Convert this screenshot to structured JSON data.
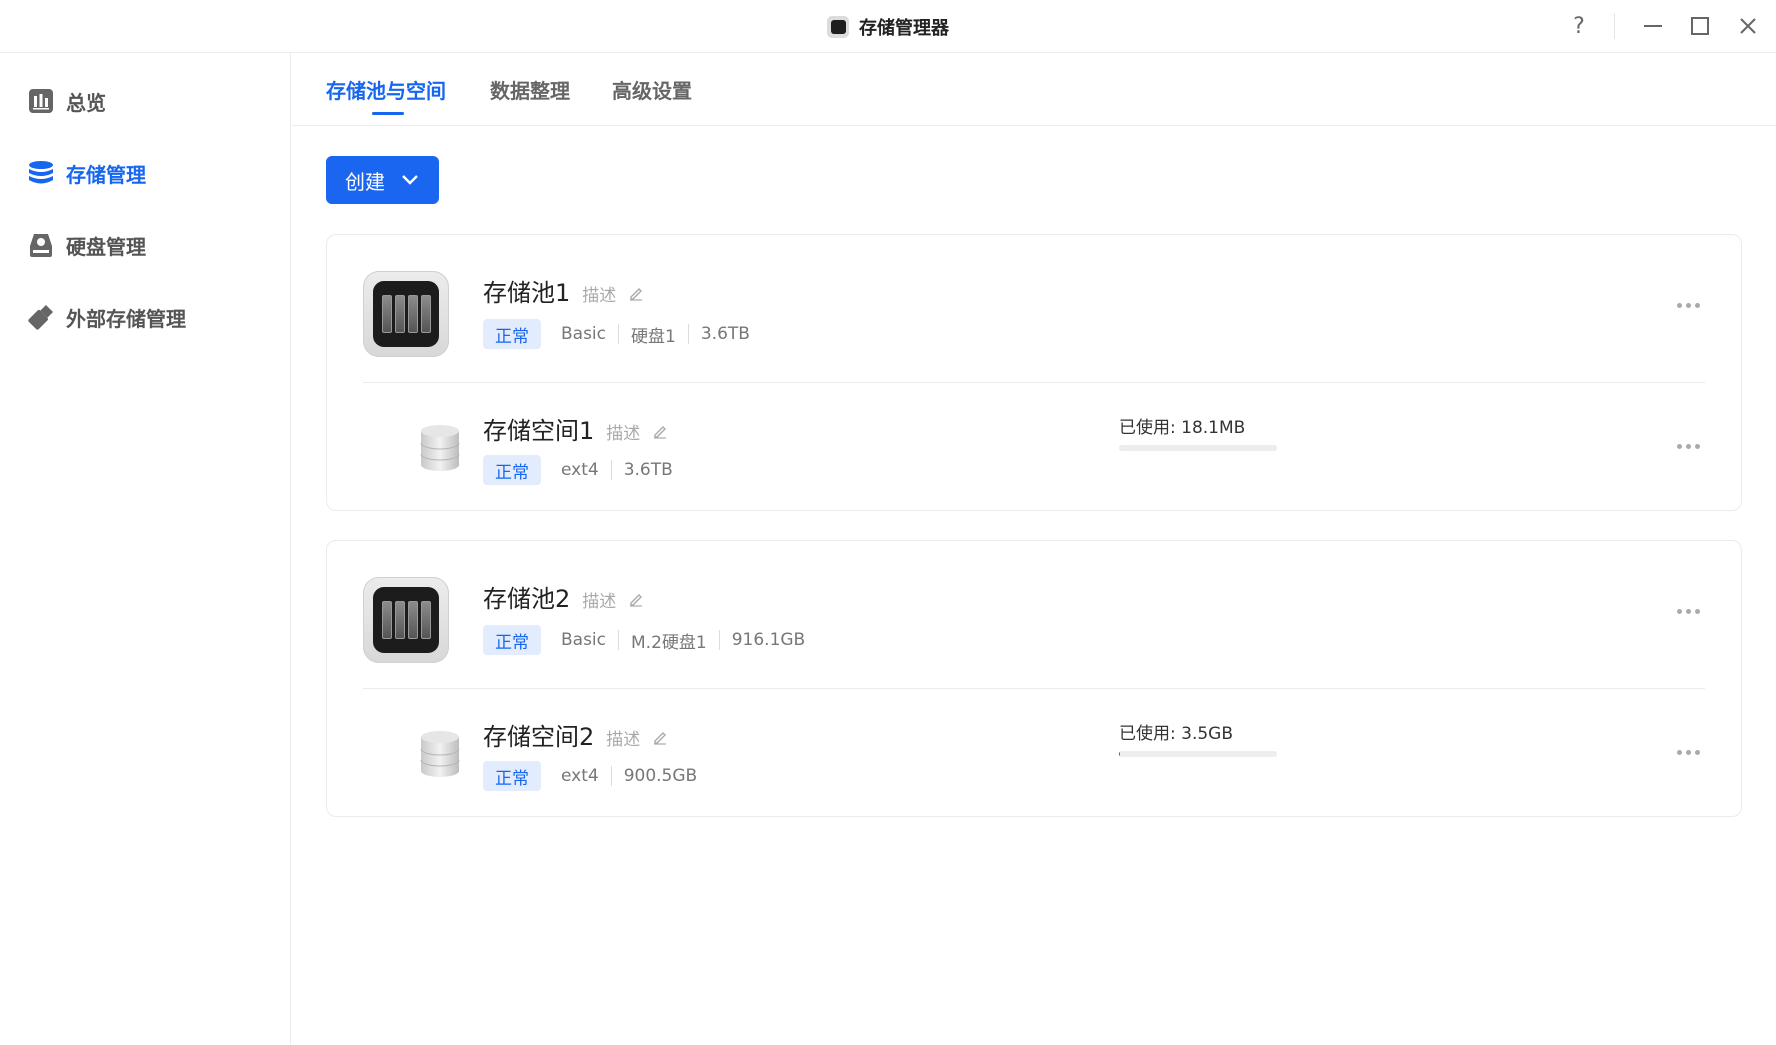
{
  "window": {
    "title": "存储管理器",
    "help_label": "?"
  },
  "sidebar": {
    "items": [
      {
        "label": "总览",
        "icon": "chart-icon",
        "active": false
      },
      {
        "label": "存储管理",
        "icon": "database-icon",
        "active": true
      },
      {
        "label": "硬盘管理",
        "icon": "disk-icon",
        "active": false
      },
      {
        "label": "外部存储管理",
        "icon": "usb-drive-icon",
        "active": false
      }
    ]
  },
  "tabs": [
    {
      "label": "存储池与空间",
      "active": true
    },
    {
      "label": "数据整理",
      "active": false
    },
    {
      "label": "高级设置",
      "active": false
    }
  ],
  "toolbar": {
    "create_label": "创建"
  },
  "pools": [
    {
      "name": "存储池1",
      "desc": "描述",
      "status": "正常",
      "raid": "Basic",
      "disk": "硬盘1",
      "size": "3.6TB",
      "volume": {
        "name": "存储空间1",
        "desc": "描述",
        "status": "正常",
        "fs": "ext4",
        "size": "3.6TB",
        "used_label": "已使用: 18.1MB",
        "used_fraction": 0.0
      }
    },
    {
      "name": "存储池2",
      "desc": "描述",
      "status": "正常",
      "raid": "Basic",
      "disk": "M.2硬盘1",
      "size": "916.1GB",
      "volume": {
        "name": "存储空间2",
        "desc": "描述",
        "status": "正常",
        "fs": "ext4",
        "size": "900.5GB",
        "used_label": "已使用: 3.5GB",
        "used_fraction": 0.004
      }
    }
  ],
  "colors": {
    "accent": "#1666f0",
    "badge_bg": "#e3ecfd"
  }
}
